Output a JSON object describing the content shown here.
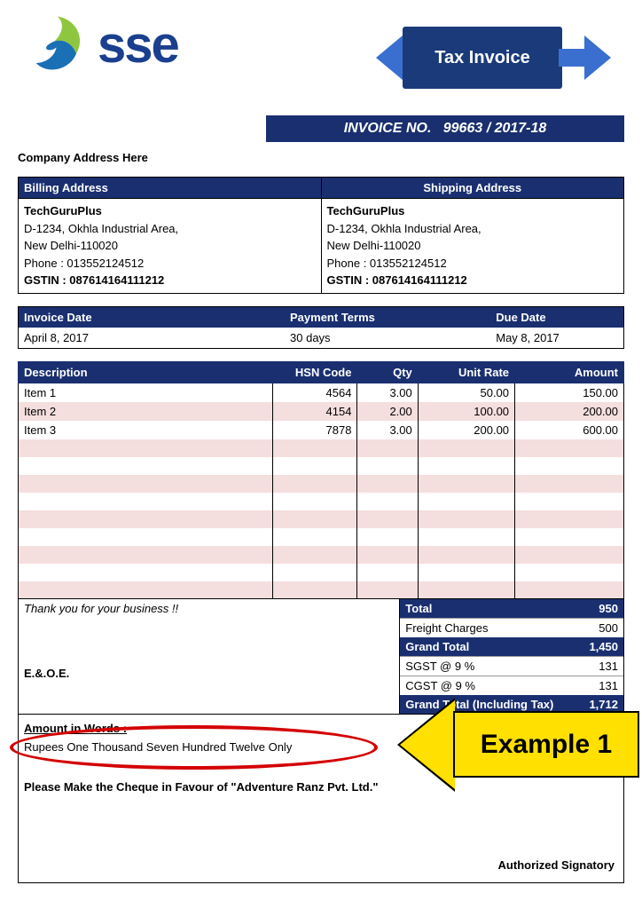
{
  "logo": {
    "text": "sse"
  },
  "banner": {
    "title": "Tax Invoice"
  },
  "invoice_no": {
    "label": "INVOICE NO.",
    "value": "99663 / 2017-18"
  },
  "company_address_label": "Company Address Here",
  "addresses": {
    "billing_header": "Billing Address",
    "shipping_header": "Shipping Address",
    "billing": {
      "name": "TechGuruPlus",
      "line1": "D-1234, Okhla Industrial Area,",
      "line2": "New Delhi-110020",
      "phone": "Phone : 013552124512",
      "gstin": "GSTIN : 087614164111212"
    },
    "shipping": {
      "name": "TechGuruPlus",
      "line1": "D-1234, Okhla Industrial Area,",
      "line2": "New Delhi-110020",
      "phone": "Phone : 013552124512",
      "gstin": "GSTIN : 087614164111212"
    }
  },
  "meta": {
    "invoice_date_label": "Invoice Date",
    "invoice_date": "April 8, 2017",
    "terms_label": "Payment Terms",
    "terms": "30 days",
    "due_label": "Due Date",
    "due": "May 8, 2017"
  },
  "columns": {
    "desc": "Description",
    "hsn": "HSN Code",
    "qty": "Qty",
    "rate": "Unit Rate",
    "amount": "Amount"
  },
  "items": [
    {
      "desc": "Item 1",
      "hsn": "4564",
      "qty": "3.00",
      "rate": "50.00",
      "amount": "150.00"
    },
    {
      "desc": "Item 2",
      "hsn": "4154",
      "qty": "2.00",
      "rate": "100.00",
      "amount": "200.00"
    },
    {
      "desc": "Item 3",
      "hsn": "7878",
      "qty": "3.00",
      "rate": "200.00",
      "amount": "600.00"
    }
  ],
  "thanks": "Thank you for your business !!",
  "eoe": "E.&.O.E.",
  "totals": {
    "total_label": "Total",
    "total": "950",
    "freight_label": "Freight Charges",
    "freight": "500",
    "grand_label": "Grand Total",
    "grand": "1,450",
    "sgst_label": "SGST @ 9 %",
    "sgst": "131",
    "cgst_label": "CGST @ 9 %",
    "cgst": "131",
    "grand_tax_label": "Grand Total (Including Tax)",
    "grand_tax": "1,712"
  },
  "footer": {
    "amount_words_label": "Amount in Words :",
    "amount_words": "Rupees One Thousand Seven Hundred Twelve Only",
    "cheque": "Please Make the Cheque in Favour of \"Adventure Ranz Pvt. Ltd.\"",
    "pvt": "t. Ltd.",
    "auth": "Authorized Signatory"
  },
  "annotation": {
    "text": "Example 1"
  }
}
